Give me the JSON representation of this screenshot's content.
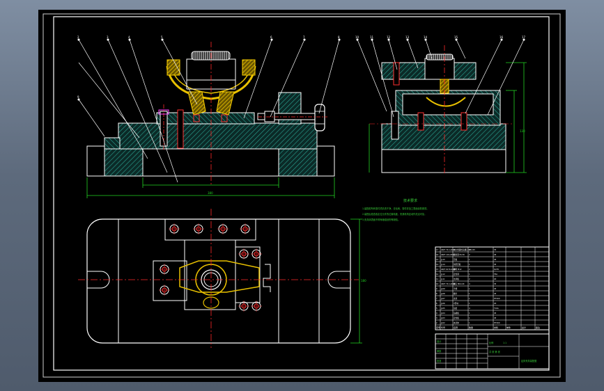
{
  "drawing": {
    "tech_requirements_title": "技术要求",
    "tech_requirements_lines": [
      "1.装配前所有零件须清洗干净，去毛刺，零件非加工表面涂防锈漆。",
      "2.装配后检查各定位元件的位置精度，夹紧机构应动作灵活可靠。",
      "3.夹具体表面不得有磕碰划伤等缺陷。"
    ],
    "front_view_callouts": [
      "2",
      "3",
      "4",
      "5",
      "6",
      "7",
      "8",
      "9"
    ],
    "side_view_callouts": [
      "10",
      "11",
      "12",
      "13",
      "14",
      "15",
      "16",
      "17"
    ],
    "dim_front_width": "380",
    "dim_side_height": "130",
    "dim_plan_depth": "180",
    "dim_plan_width": "380"
  },
  "bom": {
    "header": [
      "序号",
      "代号",
      "名称",
      "数量",
      "材料",
      "单件",
      "总计",
      "备注"
    ],
    "rows": [
      [
        "17",
        "GB/T 70.1-2000",
        "内六角圆柱头螺钉 M8×25",
        "4",
        "35",
        "",
        "",
        ""
      ],
      [
        "16",
        "GB/T 119-2000",
        "圆柱销 8×30",
        "2",
        "45",
        "",
        "",
        ""
      ],
      [
        "15",
        "JJ-15",
        "压板",
        "1",
        "45",
        "",
        "",
        ""
      ],
      [
        "14",
        "JJ-14",
        "钩形压板",
        "1",
        "45",
        "",
        "",
        ""
      ],
      [
        "13",
        "GB/T 6170-2000",
        "螺母 M12",
        "2",
        "Q235",
        "",
        "",
        ""
      ],
      [
        "12",
        "JJ-12",
        "定位销",
        "1",
        "T8A",
        "",
        "",
        ""
      ],
      [
        "11",
        "JJ-11",
        "支承板",
        "2",
        "20",
        "",
        "",
        ""
      ],
      [
        "10",
        "GB/T 70.1-2000",
        "螺钉 M6×20",
        "4",
        "35",
        "",
        "",
        ""
      ],
      [
        "9",
        "JJ-09",
        "手柄",
        "1",
        "45",
        "",
        "",
        ""
      ],
      [
        "8",
        "JJ-08",
        "螺杆",
        "1",
        "45",
        "",
        "",
        ""
      ],
      [
        "7",
        "JJ-07",
        "支座",
        "1",
        "HT200",
        "",
        "",
        ""
      ],
      [
        "6",
        "JJ-06",
        "V形块",
        "1",
        "20",
        "",
        "",
        ""
      ],
      [
        "5",
        "JJ-05",
        "钻套",
        "4",
        "T10A",
        "",
        "",
        ""
      ],
      [
        "4",
        "JJ-04",
        "钻模板",
        "1",
        "45",
        "",
        "",
        ""
      ],
      [
        "3",
        "JJ-03",
        "定位板",
        "1",
        "45",
        "",
        "",
        ""
      ],
      [
        "2",
        "JJ-02",
        "夹具体",
        "1",
        "HT200",
        "",
        "",
        ""
      ]
    ],
    "title_block": {
      "title": "钻床夹具装配图",
      "scale_label": "比例",
      "scale": "1:1",
      "sheet_label": "共 张 第 张",
      "design_label": "设计",
      "check_label": "审核",
      "approve_label": "批准"
    }
  },
  "colors": {
    "outline": "#ffffff",
    "hatch": "#1f9a8a",
    "yellow_part": "#e8c000",
    "red_hole": "#ff3030",
    "centerline": "#ff2a2a",
    "dimension": "#22d422",
    "leader": "#ffffff",
    "magenta": "#ff40ff",
    "cyan": "#33e0e0"
  }
}
